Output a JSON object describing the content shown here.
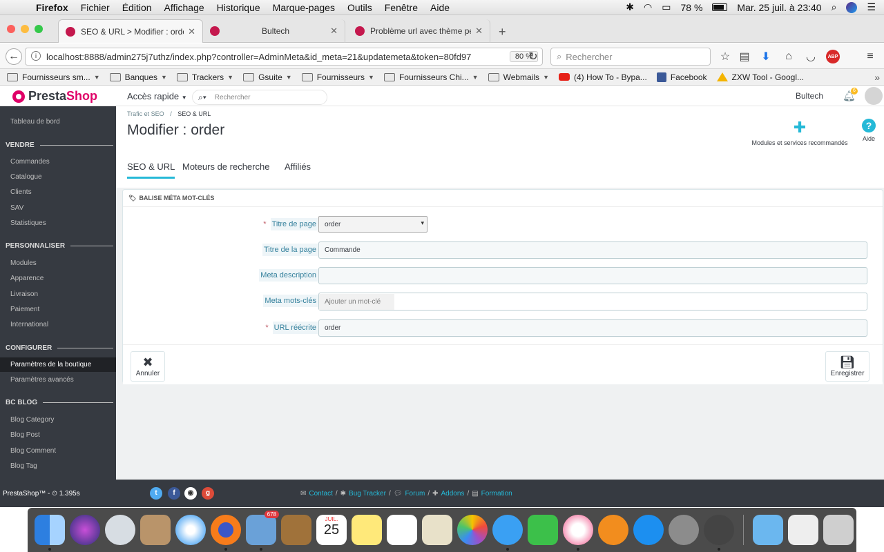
{
  "menubar": {
    "app": "Firefox",
    "items": [
      "Fichier",
      "Édition",
      "Affichage",
      "Historique",
      "Marque-pages",
      "Outils",
      "Fenêtre",
      "Aide"
    ],
    "battery": "78 %",
    "clock": "Mar. 25 juil. à 23:40"
  },
  "tabs": [
    {
      "label": "SEO & URL > Modifier : order",
      "active": true
    },
    {
      "label": "Bultech",
      "active": false
    },
    {
      "label": "Problème url avec thème pers",
      "active": false
    }
  ],
  "nav": {
    "url": "localhost:8888/admin275j7uthz/index.php?controller=AdminMeta&id_meta=21&updatemeta&token=80fd97",
    "zoom": "80 %",
    "search_placeholder": "Rechercher"
  },
  "bookmarks": [
    {
      "label": "Fournisseurs sm...",
      "type": "folder"
    },
    {
      "label": "Banques",
      "type": "folder"
    },
    {
      "label": "Trackers",
      "type": "folder"
    },
    {
      "label": "Gsuite",
      "type": "folder"
    },
    {
      "label": "Fournisseurs",
      "type": "folder"
    },
    {
      "label": "Fournisseurs Chi...",
      "type": "folder"
    },
    {
      "label": "Webmails",
      "type": "folder"
    },
    {
      "label": "(4) How To - Bypa...",
      "type": "link"
    },
    {
      "label": "Facebook",
      "type": "link"
    },
    {
      "label": "ZXW Tool - Googl...",
      "type": "link"
    }
  ],
  "ps_header": {
    "logo_a": "Presta",
    "logo_b": "Shop",
    "quick_access": "Accès rapide",
    "search_placeholder": "Rechercher",
    "shop_name": "Bultech",
    "notif_count": "6"
  },
  "sidebar": {
    "dashboard": "Tableau de bord",
    "sections": [
      {
        "title": "VENDRE",
        "items": [
          "Commandes",
          "Catalogue",
          "Clients",
          "SAV",
          "Statistiques"
        ]
      },
      {
        "title": "PERSONNALISER",
        "items": [
          "Modules",
          "Apparence",
          "Livraison",
          "Paiement",
          "International"
        ]
      },
      {
        "title": "CONFIGURER",
        "items": [
          "Paramètres de la boutique",
          "Paramètres avancés"
        ]
      },
      {
        "title": "BC BLOG",
        "items": [
          "Blog Category",
          "Blog Post",
          "Blog Comment",
          "Blog Tag"
        ]
      }
    ],
    "active": "Paramètres de la boutique"
  },
  "page": {
    "breadcrumb_1": "Trafic et SEO",
    "breadcrumb_sep": "/",
    "breadcrumb_2": "SEO & URL",
    "title": "Modifier : order",
    "recommended": "Modules et services recommandés",
    "help": "Aide",
    "tabs": [
      "SEO & URL",
      "Moteurs de recherche",
      "Affiliés"
    ]
  },
  "form": {
    "panel_title": "BALISE MÉTA MOT-CLÉS",
    "fields": {
      "page_label": "Titre de page",
      "page_value": "order",
      "title_label": "Titre de la page",
      "title_value": "Commande",
      "desc_label": "Meta description",
      "desc_value": "",
      "keywords_label": "Meta mots-clés",
      "keywords_placeholder": "Ajouter un mot-clé",
      "url_label": "URL réécrite",
      "url_value": "order"
    },
    "cancel": "Annuler",
    "save": "Enregistrer"
  },
  "footer": {
    "version": "PrestaShop™ - ⏲ 1.395s",
    "links": [
      "Contact",
      "Bug Tracker",
      "Forum",
      "Addons",
      "Formation"
    ]
  },
  "dock": {
    "mail_badge": "678",
    "calendar_month": "JUIL.",
    "calendar_day": "25"
  }
}
